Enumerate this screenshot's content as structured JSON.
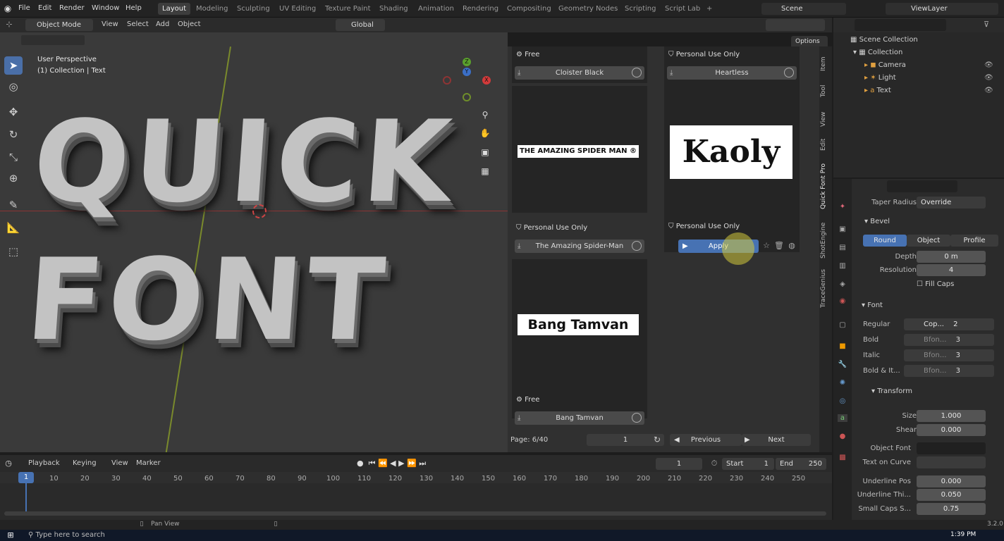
{
  "menus": [
    "File",
    "Edit",
    "Render",
    "Window",
    "Help"
  ],
  "workspaces": [
    "Layout",
    "Modeling",
    "Sculpting",
    "UV Editing",
    "Texture Paint",
    "Shading",
    "Animation",
    "Rendering",
    "Compositing",
    "Geometry Nodes",
    "Scripting",
    "Script Lab",
    "+"
  ],
  "scene": {
    "scene_label": "Scene",
    "view_layer_label": "ViewLayer"
  },
  "viewport_header": {
    "mode": "Object Mode",
    "menus": [
      "View",
      "Select",
      "Add",
      "Object"
    ],
    "orientation": "Global",
    "options": "Options"
  },
  "viewport": {
    "perspective": "User Perspective",
    "collection_info": "(1) Collection | Text",
    "text_line1": "QUICK",
    "text_line2": "FONT",
    "axis_labels": {
      "x": "X",
      "y": "Y",
      "z": "Z"
    }
  },
  "font_panel": {
    "cards": [
      {
        "license": "Free",
        "name": "Cloister Black",
        "preview": ""
      },
      {
        "license": "Personal Use Only",
        "name": "Heartless",
        "preview": "Kaoly"
      },
      {
        "license": "Personal Use Only",
        "name": "The Amazing Spider-Man",
        "preview": "THE AMAZING SPIDER MAN ®"
      },
      {
        "license": "Personal Use Only",
        "name": "Apply",
        "preview": ""
      },
      {
        "license": "Free",
        "name": "Bang Tamvan",
        "preview": "Bang Tamvan"
      }
    ],
    "page": "Page: 6/40",
    "page_input": "1",
    "prev": "Previous",
    "next": "Next"
  },
  "side_tabs": [
    "Item",
    "Tool",
    "View",
    "Edit",
    "Quick Font Pro",
    "ShotEngine",
    "TraceGenius"
  ],
  "outliner": {
    "root": "Scene Collection",
    "collection": "Collection",
    "items": [
      "Camera",
      "Light",
      "Text"
    ]
  },
  "properties": {
    "taper_radius_label": "Taper Radius",
    "taper_radius_value": "Override",
    "bevel": "Bevel",
    "bevel_modes": [
      "Round",
      "Object",
      "Profile"
    ],
    "depth_label": "Depth",
    "depth_value": "0 m",
    "resolution_label": "Resolution",
    "resolution_value": "4",
    "fill_caps": "Fill Caps",
    "font": "Font",
    "font_rows": [
      {
        "label": "Regular",
        "value": "Cop...",
        "users": "2"
      },
      {
        "label": "Bold",
        "value": "Bfon...",
        "users": "3"
      },
      {
        "label": "Italic",
        "value": "Bfon...",
        "users": "3"
      },
      {
        "label": "Bold & It...",
        "value": "Bfon...",
        "users": "3"
      }
    ],
    "transform": "Transform",
    "size_label": "Size",
    "size_value": "1.000",
    "shear_label": "Shear",
    "shear_value": "0.000",
    "object_font_label": "Object Font",
    "text_on_curve_label": "Text on Curve",
    "underline_pos_label": "Underline Pos",
    "underline_pos_value": "0.000",
    "underline_thi_label": "Underline Thi...",
    "underline_thi_value": "0.050",
    "small_caps_label": "Small Caps S...",
    "small_caps_value": "0.75"
  },
  "timeline": {
    "menus": [
      "Playback",
      "Keying",
      "View",
      "Marker"
    ],
    "current_frame": "1",
    "start_label": "Start",
    "start": "1",
    "end_label": "End",
    "end": "250",
    "ticks": [
      "1",
      "10",
      "20",
      "30",
      "40",
      "50",
      "60",
      "70",
      "80",
      "90",
      "100",
      "110",
      "120",
      "130",
      "140",
      "150",
      "160",
      "170",
      "180",
      "190",
      "200",
      "210",
      "220",
      "230",
      "240",
      "250"
    ]
  },
  "status": {
    "pan_view": "Pan View",
    "version": "3.2.0"
  },
  "taskbar": {
    "search_placeholder": "Type here to search",
    "clock": "1:39 PM"
  },
  "colors": {
    "accent": "#4a6fa8",
    "active_button": "#4772b3",
    "viewport_bg": "#3a3a3a",
    "panel_bg": "#303030"
  }
}
